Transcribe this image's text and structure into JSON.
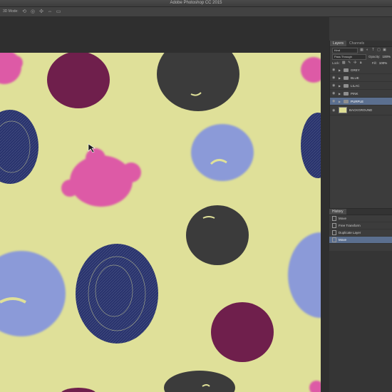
{
  "window": {
    "title": "Adobe Photoshop CC 2015"
  },
  "options_bar": {
    "mode_label": "3D Mode:"
  },
  "layers_panel": {
    "tabs": [
      "Layers",
      "Channels"
    ],
    "kind_filter": "Kind",
    "blend_mode": "Pass Through",
    "opacity_label": "Opacity:",
    "opacity_value": "100%",
    "lock_label": "Lock:",
    "fill_label": "Fill:",
    "fill_value": "100%",
    "layers": [
      {
        "name": "GREY",
        "type": "group"
      },
      {
        "name": "BLUE",
        "type": "group"
      },
      {
        "name": "LILAC",
        "type": "group"
      },
      {
        "name": "PINK",
        "type": "group"
      },
      {
        "name": "PURPLE",
        "type": "group",
        "selected": true
      },
      {
        "name": "BACKGROUND",
        "type": "layer"
      }
    ]
  },
  "history_panel": {
    "tab": "History",
    "items": [
      {
        "label": "Move"
      },
      {
        "label": "Free Transform"
      },
      {
        "label": "Duplicate Layer"
      },
      {
        "label": "Move",
        "active": true
      }
    ]
  },
  "canvas": {
    "background": "#dfe099",
    "colors": {
      "purple": "#6f1f4c",
      "grey": "#3b3b3b",
      "blue": "#8b9ad8",
      "pink": "#dd5aa6",
      "navy": "#1f2a6b"
    }
  }
}
